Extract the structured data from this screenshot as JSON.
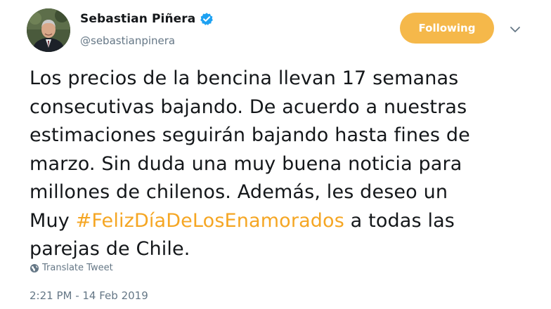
{
  "author": {
    "display_name": "Sebastian Piñera",
    "handle": "@sebastianpinera",
    "verified": true,
    "avatar_icon": "profile-photo"
  },
  "follow_button": {
    "label": "Following",
    "color": "#f5b84a"
  },
  "menu": {
    "icon": "chevron-down-icon"
  },
  "tweet": {
    "lines": [
      "Los precios de la bencina llevan 17 semanas",
      "consecutivas bajando. De acuerdo a nuestras",
      "estimaciones seguirán bajando hasta fines de",
      "marzo. Sin duda una muy buena noticia para",
      "millones de chilenos. Además, les deseo un"
    ],
    "line6_before": "Muy ",
    "hashtag": "#FelizDíaDeLosEnamorados",
    "line6_after": " a todas las",
    "line7": "parejas de Chile.",
    "hashtag_color": "#f5a623"
  },
  "translate": {
    "label": "Translate Tweet",
    "icon": "globe-icon"
  },
  "timestamp": "2:21 PM - 14 Feb 2019"
}
